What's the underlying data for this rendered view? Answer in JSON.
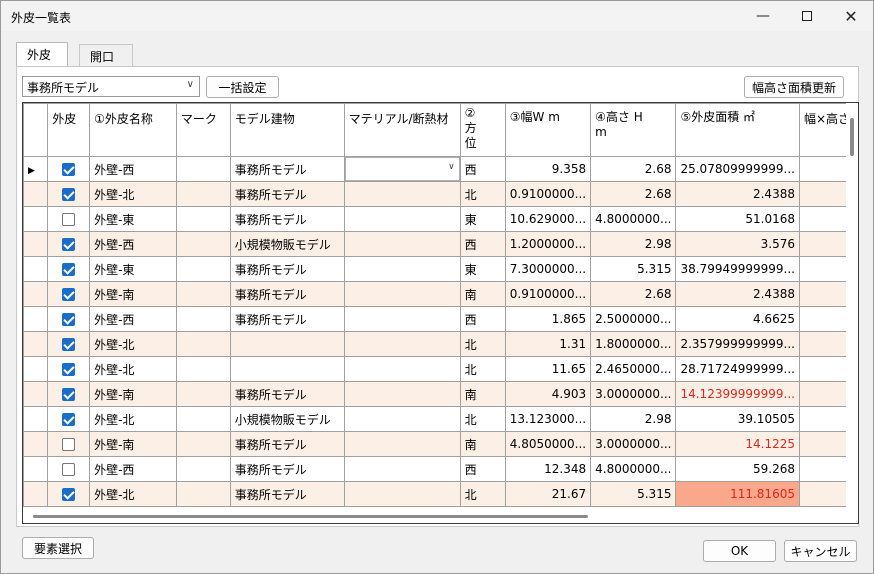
{
  "window": {
    "title": "外皮一覧表"
  },
  "tabs": [
    {
      "label": "外皮"
    },
    {
      "label": "開口"
    }
  ],
  "toolbar": {
    "model_select": "事務所モデル",
    "bulk_set_label": "一括設定",
    "update_area_label": "幅高さ面積更新"
  },
  "grid": {
    "headers": {
      "include": "外皮",
      "name": "①外皮名称",
      "mark": "マーク",
      "model_building": "モデル建物",
      "material": "マテリアル/断熱材",
      "direction": "②方位",
      "width": "③幅W m",
      "height": "④高さ H m",
      "area": "⑤外皮面積 ㎡",
      "wxh": "幅×高さ"
    },
    "rows": [
      {
        "checked": true,
        "name": "外壁-西",
        "mark": "",
        "model": "事務所モデル",
        "material": "",
        "dir": "西",
        "w": "9.358",
        "h": "2.68",
        "area": "25.07809999999...",
        "area_style": ""
      },
      {
        "checked": true,
        "name": "外壁-北",
        "mark": "",
        "model": "事務所モデル",
        "material": "",
        "dir": "北",
        "w": "0.9100000...",
        "h": "2.68",
        "area": "2.4388",
        "area_style": ""
      },
      {
        "checked": false,
        "name": "外壁-東",
        "mark": "",
        "model": "事務所モデル",
        "material": "",
        "dir": "東",
        "w": "10.629000...",
        "h": "4.8000000...",
        "area": "51.0168",
        "area_style": ""
      },
      {
        "checked": true,
        "name": "外壁-西",
        "mark": "",
        "model": "小規模物販モデル",
        "material": "",
        "dir": "西",
        "w": "1.2000000...",
        "h": "2.98",
        "area": "3.576",
        "area_style": ""
      },
      {
        "checked": true,
        "name": "外壁-東",
        "mark": "",
        "model": "事務所モデル",
        "material": "",
        "dir": "東",
        "w": "7.3000000...",
        "h": "5.315",
        "area": "38.79949999999...",
        "area_style": ""
      },
      {
        "checked": true,
        "name": "外壁-南",
        "mark": "",
        "model": "事務所モデル",
        "material": "",
        "dir": "南",
        "w": "0.9100000...",
        "h": "2.68",
        "area": "2.4388",
        "area_style": ""
      },
      {
        "checked": true,
        "name": "外壁-西",
        "mark": "",
        "model": "事務所モデル",
        "material": "",
        "dir": "西",
        "w": "1.865",
        "h": "2.5000000...",
        "area": "4.6625",
        "area_style": ""
      },
      {
        "checked": true,
        "name": "外壁-北",
        "mark": "",
        "model": "",
        "material": "",
        "dir": "北",
        "w": "1.31",
        "h": "1.8000000...",
        "area": "2.357999999999...",
        "area_style": ""
      },
      {
        "checked": true,
        "name": "外壁-北",
        "mark": "",
        "model": "",
        "material": "",
        "dir": "北",
        "w": "11.65",
        "h": "2.4650000...",
        "area": "28.71724999999...",
        "area_style": ""
      },
      {
        "checked": true,
        "name": "外壁-南",
        "mark": "",
        "model": "事務所モデル",
        "material": "",
        "dir": "南",
        "w": "4.903",
        "h": "3.0000000...",
        "area": "14.12399999999...",
        "area_style": "red"
      },
      {
        "checked": true,
        "name": "外壁-北",
        "mark": "",
        "model": "小規模物販モデル",
        "material": "",
        "dir": "北",
        "w": "13.123000...",
        "h": "2.98",
        "area": "39.10505",
        "area_style": ""
      },
      {
        "checked": false,
        "name": "外壁-南",
        "mark": "",
        "model": "事務所モデル",
        "material": "",
        "dir": "南",
        "w": "4.8050000...",
        "h": "3.0000000...",
        "area": "14.1225",
        "area_style": "red"
      },
      {
        "checked": false,
        "name": "外壁-西",
        "mark": "",
        "model": "事務所モデル",
        "material": "",
        "dir": "西",
        "w": "12.348",
        "h": "4.8000000...",
        "area": "59.268",
        "area_style": ""
      },
      {
        "checked": true,
        "name": "外壁-北",
        "mark": "",
        "model": "事務所モデル",
        "material": "",
        "dir": "北",
        "w": "21.67",
        "h": "5.315",
        "area": "111.81605",
        "area_style": "red-orange"
      }
    ]
  },
  "footer": {
    "select_elements_label": "要素選択",
    "ok_label": "OK",
    "cancel_label": "キャンセル"
  }
}
